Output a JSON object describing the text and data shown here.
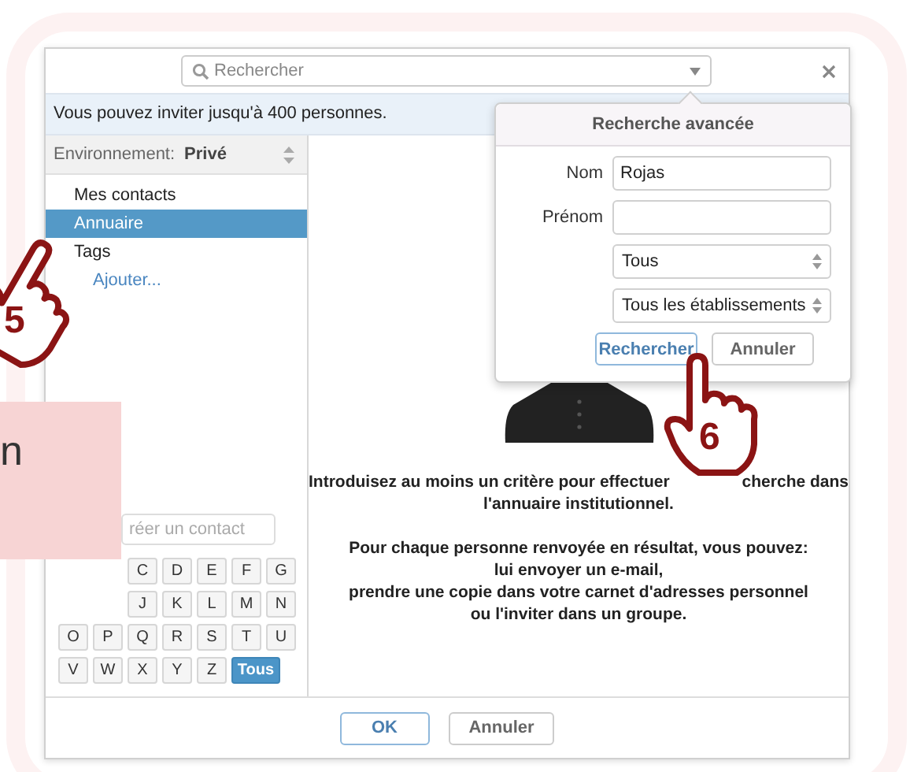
{
  "search": {
    "placeholder": "Rechercher"
  },
  "info_bar": "Vous pouvez inviter jusqu'à 400 personnes.",
  "environment": {
    "label": "Environnement:",
    "value": "Privé"
  },
  "sidebar": {
    "items": [
      {
        "label": "Mes contacts",
        "selected": false
      },
      {
        "label": "Annuaire",
        "selected": true
      },
      {
        "label": "Tags",
        "selected": false,
        "children": [
          {
            "label": "Ajouter..."
          }
        ]
      }
    ]
  },
  "create_contact": {
    "placeholder": "réer un contact"
  },
  "letters": {
    "rows": [
      [
        {
          "label": "C",
          "selected": false
        },
        {
          "label": "D",
          "selected": false
        },
        {
          "label": "E",
          "selected": false
        },
        {
          "label": "F",
          "selected": false
        },
        {
          "label": "G",
          "selected": false
        }
      ],
      [
        {
          "label": "J",
          "selected": false
        },
        {
          "label": "K",
          "selected": false
        },
        {
          "label": "L",
          "selected": false
        },
        {
          "label": "M",
          "selected": false
        },
        {
          "label": "N",
          "selected": false
        }
      ],
      [
        {
          "label": "O",
          "selected": false
        },
        {
          "label": "P",
          "selected": false
        },
        {
          "label": "Q",
          "selected": false
        },
        {
          "label": "R",
          "selected": false
        },
        {
          "label": "S",
          "selected": false
        },
        {
          "label": "T",
          "selected": false
        },
        {
          "label": "U",
          "selected": false
        }
      ],
      [
        {
          "label": "V",
          "selected": false
        },
        {
          "label": "W",
          "selected": false
        },
        {
          "label": "X",
          "selected": false
        },
        {
          "label": "Y",
          "selected": false
        },
        {
          "label": "Z",
          "selected": false
        },
        {
          "label": "Tous",
          "selected": true
        }
      ]
    ]
  },
  "message": {
    "line_1_start": "Introduisez au moins un critère pour effectuer",
    "line_1_end": "cherche dans",
    "line_2": "l'annuaire institutionnel.",
    "paragraph_2": [
      "Pour chaque personne renvoyée en résultat, vous pouvez:",
      "lui envoyer un e-mail,",
      "prendre une copie dans votre carnet d'adresses personnel",
      "ou l'inviter dans un groupe."
    ]
  },
  "footer_buttons": [
    {
      "label": "OK",
      "kind": "primary"
    },
    {
      "label": "Annuler",
      "kind": "default"
    }
  ],
  "advanced_search": {
    "title": "Recherche avancée",
    "fields": [
      {
        "kind": "text",
        "label": "Nom",
        "value": "Rojas"
      },
      {
        "kind": "text",
        "label": "Prénom"
      },
      {
        "kind": "select",
        "value": "Tous"
      },
      {
        "kind": "select",
        "value": "Tous les établissements"
      }
    ],
    "buttons": [
      {
        "label": "Rechercher",
        "kind": "primary"
      },
      {
        "label": "Annuler",
        "kind": "default"
      }
    ]
  },
  "callouts": [
    {
      "number": "5"
    },
    {
      "number": "6"
    }
  ],
  "note": {
    "text": "n"
  }
}
